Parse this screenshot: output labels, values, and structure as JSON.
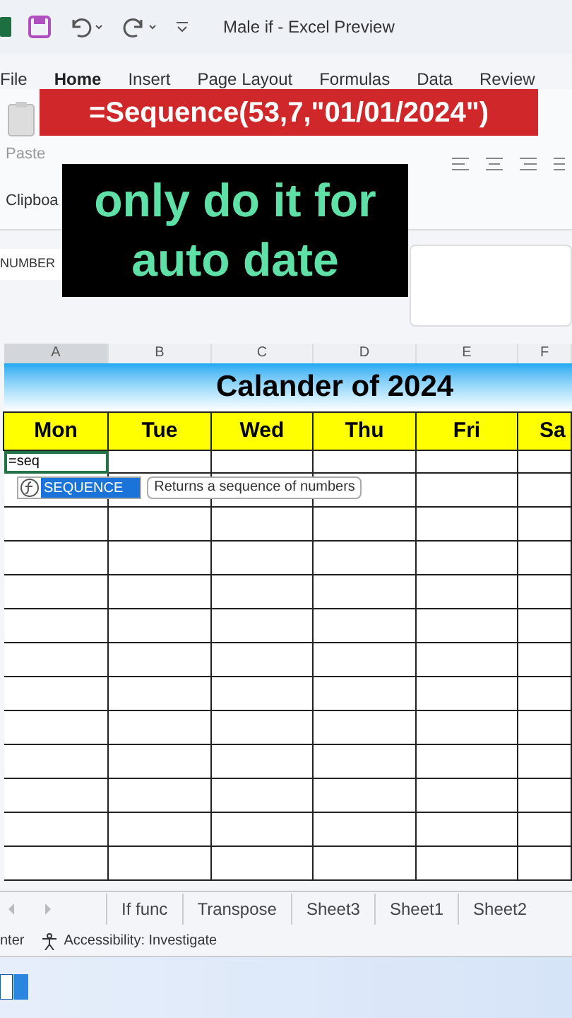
{
  "title_bar": {
    "title": "Male if  -  Excel Preview"
  },
  "ribbon_tabs": [
    {
      "label": "File",
      "selected": false
    },
    {
      "label": "Home",
      "selected": true
    },
    {
      "label": "Insert",
      "selected": false
    },
    {
      "label": "Page Layout",
      "selected": false
    },
    {
      "label": "Formulas",
      "selected": false
    },
    {
      "label": "Data",
      "selected": false
    },
    {
      "label": "Review",
      "selected": false
    }
  ],
  "ribbon": {
    "paste_label": "Paste",
    "group_label": "Clipboa"
  },
  "name_box": {
    "value": "NUMBER"
  },
  "captions": [
    {
      "kind": "red",
      "text": "=Sequence(53,7,\"01/01/2024\")"
    },
    {
      "kind": "black",
      "text": "only do it for auto date"
    }
  ],
  "sheet": {
    "column_headers": [
      {
        "label": "A",
        "selected": true
      },
      {
        "label": "B",
        "selected": false
      },
      {
        "label": "C",
        "selected": false
      },
      {
        "label": "D",
        "selected": false
      },
      {
        "label": "E",
        "selected": false
      },
      {
        "label": "F",
        "selected": false
      }
    ],
    "title": "Calander of 2024",
    "days": [
      "Mon",
      "Tue",
      "Wed",
      "Thu",
      "Fri",
      "Sa"
    ],
    "active_cell": "=seq",
    "autocomplete": {
      "item": "SEQUENCE",
      "tooltip": "Returns a sequence of numbers"
    }
  },
  "sheet_tabs": [
    {
      "label": "If func",
      "selected": false
    },
    {
      "label": "Transpose",
      "selected": false
    },
    {
      "label": "Sheet3",
      "selected": false
    },
    {
      "label": "Sheet1",
      "selected": false
    },
    {
      "label": "Sheet2",
      "selected": false
    }
  ],
  "status_bar": [
    "nter",
    "Accessibility: Investigate"
  ]
}
